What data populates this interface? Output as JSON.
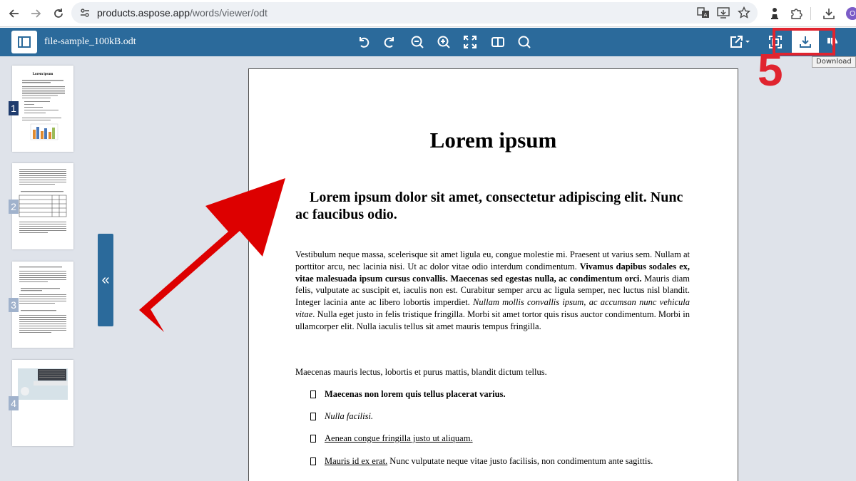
{
  "browser": {
    "url_host": "products.aspose.app",
    "url_path": "/words/viewer/odt",
    "profile_initial": "O"
  },
  "app": {
    "file_name": "file-sample_100kB.odt",
    "tooltip": "Download"
  },
  "annotation": {
    "step": "5",
    "color": "#e0242f"
  },
  "thumbnails": [
    {
      "number": "1",
      "title": "Lorem ipsum"
    },
    {
      "number": "2"
    },
    {
      "number": "3"
    },
    {
      "number": "4"
    }
  ],
  "collapse_label": "«",
  "document": {
    "title": "Lorem ipsum",
    "heading": "Lorem ipsum dolor sit amet, consectetur adipiscing elit. Nunc ac faucibus odio.",
    "para1": {
      "a": "Vestibulum neque massa, scelerisque sit amet ligula eu, congue molestie mi. Praesent ut varius sem. Nullam at porttitor arcu, nec lacinia nisi. Ut ac dolor vitae odio interdum condimentum. ",
      "b": "Vivamus dapibus sodales ex, vitae malesuada ipsum cursus convallis. Maecenas sed egestas nulla, ac condimentum orci.",
      "c": " Mauris diam felis, vulputate ac suscipit et, iaculis non est. Curabitur semper arcu ac ligula semper, nec luctus nisl blandit. Integer lacinia ante ac libero lobortis imperdiet. ",
      "d": "Nullam mollis convallis ipsum, ac accumsan nunc vehicula vitae",
      "e": ". Nulla eget justo in felis tristique fringilla. Morbi sit amet tortor quis risus auctor condimentum. Morbi in ullamcorper elit. Nulla iaculis tellus sit amet mauris tempus fringilla."
    },
    "para2": "Maecenas mauris lectus, lobortis et purus mattis, blandit dictum tellus.",
    "bullets": {
      "b1": "Maecenas non lorem quis tellus placerat varius.",
      "b2": "Nulla facilisi.",
      "b3": "Aenean congue fringilla justo ut aliquam.",
      "b4_u": "Mauris id ex erat.",
      "b4_rest": " Nunc vulputate neque vitae justo facilisis, non condimentum ante sagittis."
    }
  }
}
